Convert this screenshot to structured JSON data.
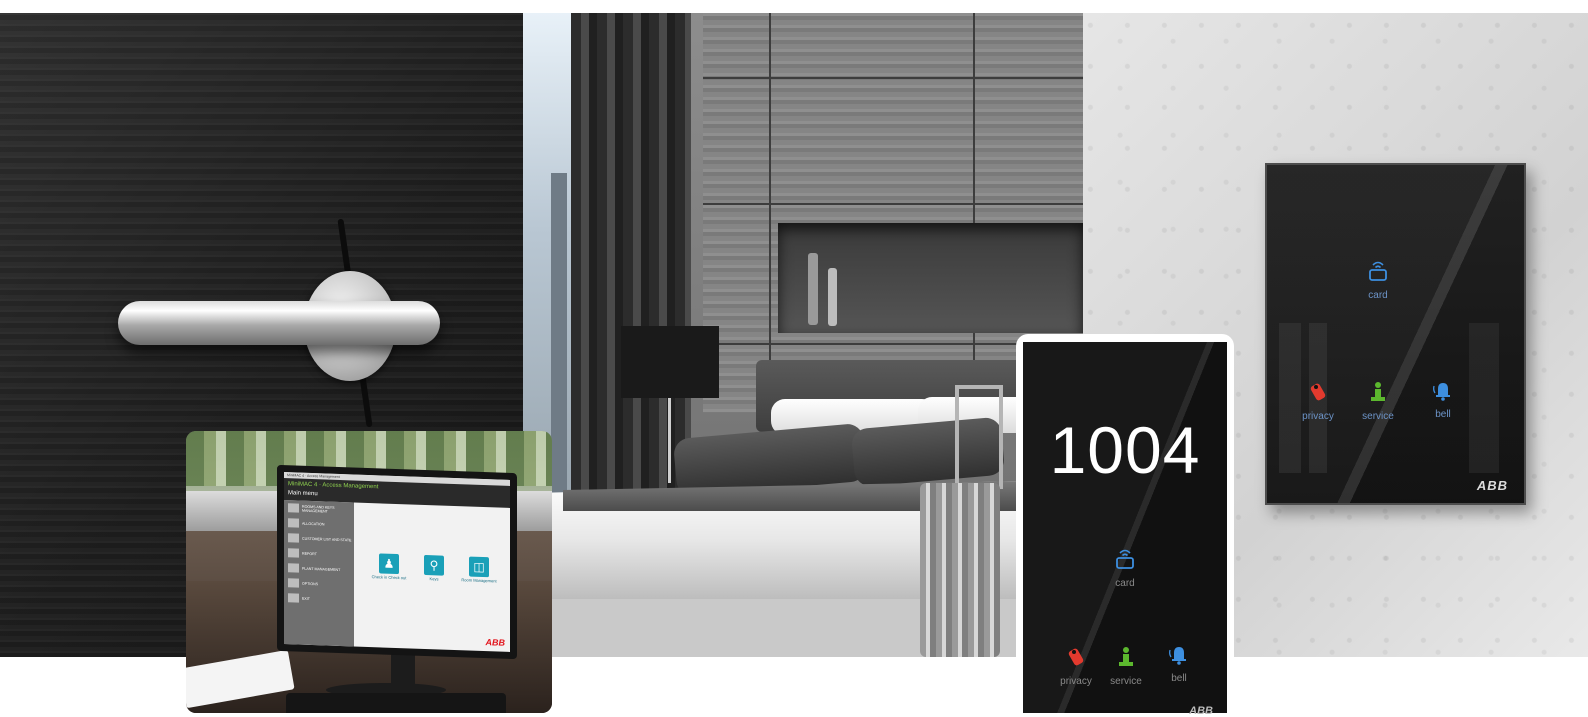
{
  "collage": {
    "scenes": [
      "door-handle",
      "hotel-bedroom",
      "concrete-wall",
      "desk-computer"
    ]
  },
  "wall_panel": {
    "items": [
      {
        "id": "card",
        "label": "card",
        "icon": "card-reader-icon",
        "color": "#3d8fe0"
      },
      {
        "id": "privacy",
        "label": "privacy",
        "icon": "privacy-tag-icon",
        "color": "#e23a2e"
      },
      {
        "id": "service",
        "label": "service",
        "icon": "service-icon",
        "color": "#5cb82e"
      },
      {
        "id": "bell",
        "label": "bell",
        "icon": "bell-icon",
        "color": "#3d8fe0"
      }
    ],
    "brand": "ABB"
  },
  "door_panel": {
    "room_number": "1004",
    "items": [
      {
        "id": "card",
        "label": "card",
        "icon": "card-reader-icon",
        "color": "#3d8fe0"
      },
      {
        "id": "privacy",
        "label": "privacy",
        "icon": "privacy-tag-icon",
        "color": "#e23a2e"
      },
      {
        "id": "service",
        "label": "service",
        "icon": "service-icon",
        "color": "#5cb82e"
      },
      {
        "id": "bell",
        "label": "bell",
        "icon": "bell-icon",
        "color": "#3d8fe0"
      }
    ],
    "brand": "ABB"
  },
  "monitor": {
    "window_title": "MiniMAC 4 · Access Management",
    "app_title": "MiniMAC 4 · Access Management",
    "app_subtitle": "Main menu",
    "menu_items": [
      "ROOMS AND KEYS MANAGEMENT",
      "ALLOCATION",
      "CUSTOMER LIST AND STATE",
      "REPORT",
      "PLANT MANAGEMENT",
      "OPTIONS",
      "EXIT"
    ],
    "tiles": [
      {
        "label": "Check in Check out",
        "icon": "check-in-icon"
      },
      {
        "label": "Keys",
        "icon": "keys-icon"
      },
      {
        "label": "Room Management",
        "icon": "room-management-icon"
      }
    ],
    "brand": "ABB"
  }
}
